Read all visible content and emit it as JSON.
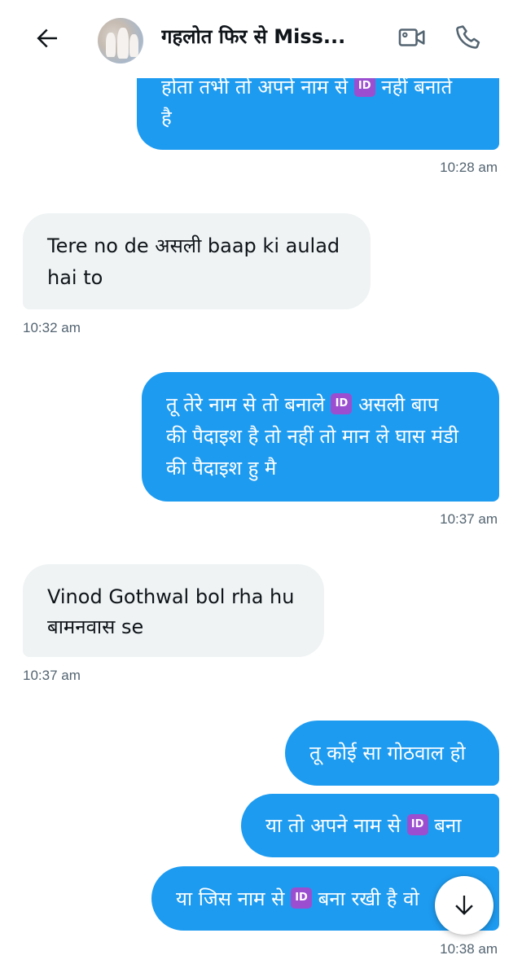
{
  "header": {
    "title": "गहलोत फिर से Miss...",
    "back_icon": "arrow-left-icon",
    "video_icon": "video-camera-icon",
    "call_icon": "phone-icon"
  },
  "colors": {
    "sent_bubble": "#1d9bf0",
    "received_bubble": "#eff3f4",
    "timestamp": "#536471",
    "id_emoji": "#9b4fd0"
  },
  "id_emoji_label": "ID",
  "messages": [
    {
      "side": "sent",
      "lines": [
        [
          "होता तभी तो अपने नाम से ",
          "ID",
          " नहीं बनाते"
        ],
        [
          "है"
        ]
      ],
      "time": "10:28 am"
    },
    {
      "side": "received",
      "lines": [
        [
          "Tere no de असली baap ki aulad"
        ],
        [
          "hai to"
        ]
      ],
      "time": "10:32 am"
    },
    {
      "side": "sent",
      "lines": [
        [
          "तू तेरे नाम से तो बनाले ",
          "ID",
          " असली बाप"
        ],
        [
          "की पैदाइश है तो नहीं तो मान ले घास मंडी"
        ],
        [
          "की पैदाइश हु मै"
        ]
      ],
      "time": "10:37 am"
    },
    {
      "side": "received",
      "lines": [
        [
          "Vinod Gothwal bol rha hu"
        ],
        [
          "बामनवास se"
        ]
      ],
      "time": "10:37 am"
    },
    {
      "side": "sent",
      "lines": [
        [
          "तू कोई सा गोठवाल हो"
        ]
      ]
    },
    {
      "side": "sent",
      "lines": [
        [
          "या तो अपने नाम से ",
          "ID",
          " बना"
        ]
      ]
    },
    {
      "side": "sent",
      "lines": [
        [
          "या जिस नाम से ",
          "ID",
          " बना रखी है वो"
        ]
      ],
      "time": "10:38 am"
    }
  ],
  "scroll_button_icon": "arrow-down-icon"
}
